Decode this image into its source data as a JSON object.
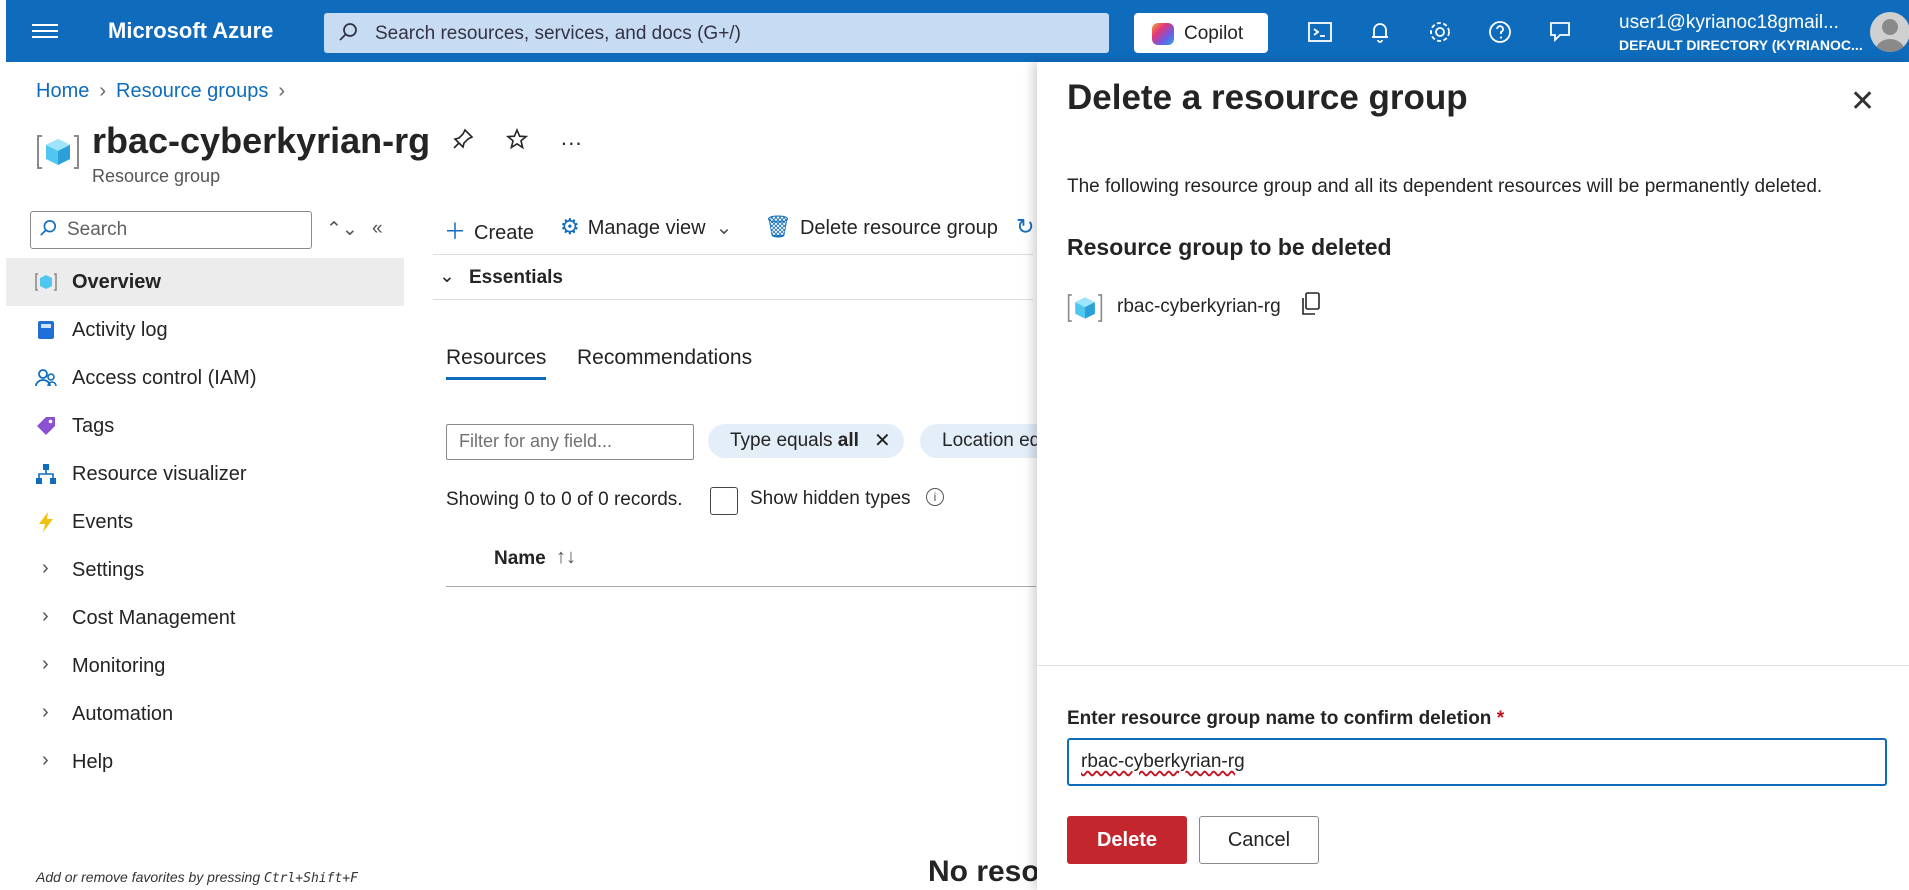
{
  "topbar": {
    "brand": "Microsoft Azure",
    "search_placeholder": "Search resources, services, and docs (G+/)",
    "copilot_label": "Copilot",
    "user_email": "user1@kyrianoc18gmail...",
    "user_directory": "DEFAULT DIRECTORY (KYRIANOC..."
  },
  "breadcrumb": {
    "home": "Home",
    "resource_groups": "Resource groups"
  },
  "resource": {
    "title": "rbac-cyberkyrian-rg",
    "subtitle": "Resource group"
  },
  "sidebar": {
    "search_placeholder": "Search",
    "items": [
      {
        "label": "Overview",
        "icon": "overview-icon"
      },
      {
        "label": "Activity log",
        "icon": "activity-log-icon"
      },
      {
        "label": "Access control (IAM)",
        "icon": "iam-icon"
      },
      {
        "label": "Tags",
        "icon": "tag-icon"
      },
      {
        "label": "Resource visualizer",
        "icon": "visualizer-icon"
      },
      {
        "label": "Events",
        "icon": "lightning-icon"
      },
      {
        "label": "Settings"
      },
      {
        "label": "Cost Management"
      },
      {
        "label": "Monitoring"
      },
      {
        "label": "Automation"
      },
      {
        "label": "Help"
      }
    ],
    "favorites_hint": "Add or remove favorites by pressing",
    "favorites_shortcut": "Ctrl+Shift+F"
  },
  "toolbar": {
    "create": "Create",
    "manage_view": "Manage view",
    "delete_rg": "Delete resource group"
  },
  "main": {
    "essentials": "Essentials",
    "tabs": [
      {
        "label": "Resources"
      },
      {
        "label": "Recommendations"
      }
    ],
    "filter_placeholder": "Filter for any field...",
    "pill_type_prefix": "Type equals ",
    "pill_type_value": "all",
    "pill_location": "Location eq",
    "records": "Showing 0 to 0 of 0 records.",
    "show_hidden": "Show hidden types",
    "col_name": "Name",
    "no_results": "No reso"
  },
  "panel": {
    "title": "Delete a resource group",
    "description": "The following resource group and all its dependent resources will be permanently deleted.",
    "section_title": "Resource group to be deleted",
    "rg_name": "rbac-cyberkyrian-rg",
    "confirm_label": "Enter resource group name to confirm deletion",
    "required_mark": "*",
    "confirm_value": "rbac-cyberkyrian-rg",
    "delete_button": "Delete",
    "cancel_button": "Cancel"
  },
  "colors": {
    "accent": "#0f6cbd",
    "danger": "#c4262e"
  }
}
